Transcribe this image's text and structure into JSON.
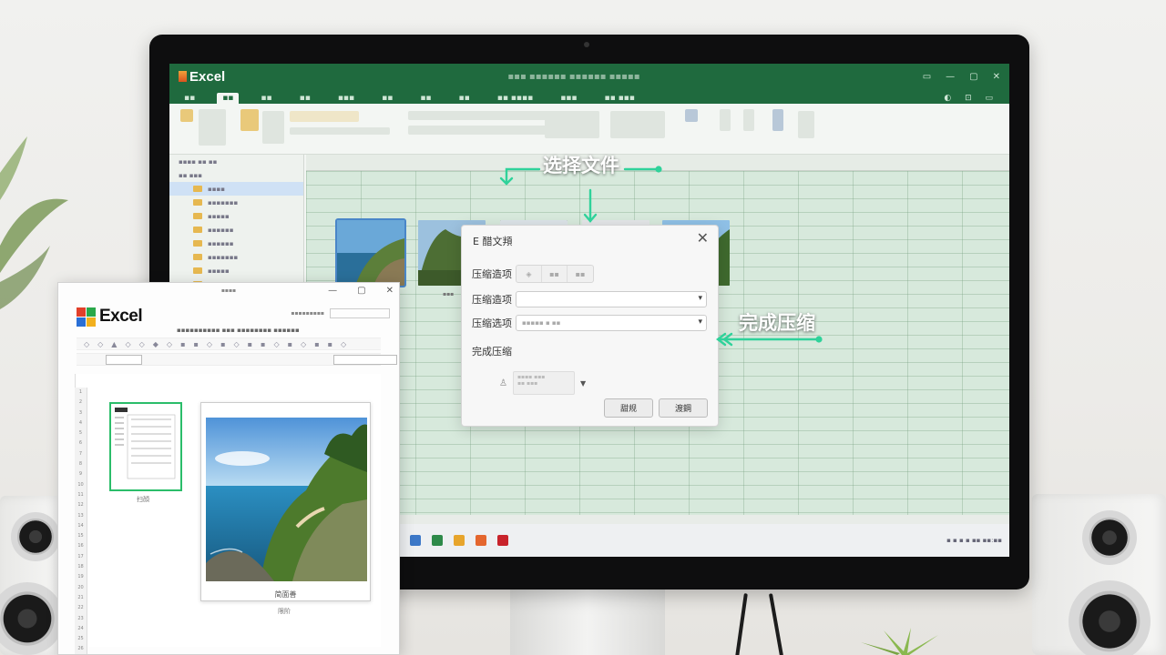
{
  "app": {
    "name": "Excel"
  },
  "annotations": {
    "select_file": "选择文件",
    "finish_compress": "完成压缩"
  },
  "dialog": {
    "title": "E 醋文頖",
    "row1_label": "压缩造项",
    "row2_label": "压缩造项",
    "row3_label": "压缩选项",
    "section_label": "完成压缩",
    "ok_button": "甜规",
    "cancel_button": "渡鋼"
  },
  "foreground_window": {
    "logo_text": "Excel",
    "card_caption": "简面善",
    "bottom_caption": "限阶",
    "mini_caption": "扫顔"
  },
  "colors": {
    "excel_green": "#1f6a3e",
    "accent_teal": "#2fd29a",
    "grid_green": "#d7e9dc",
    "selection_blue": "#4a86c8"
  },
  "icons": [
    "close-icon",
    "chevron-down-icon",
    "user-icon",
    "excel-logo-icon",
    "windows-logo-icon"
  ]
}
